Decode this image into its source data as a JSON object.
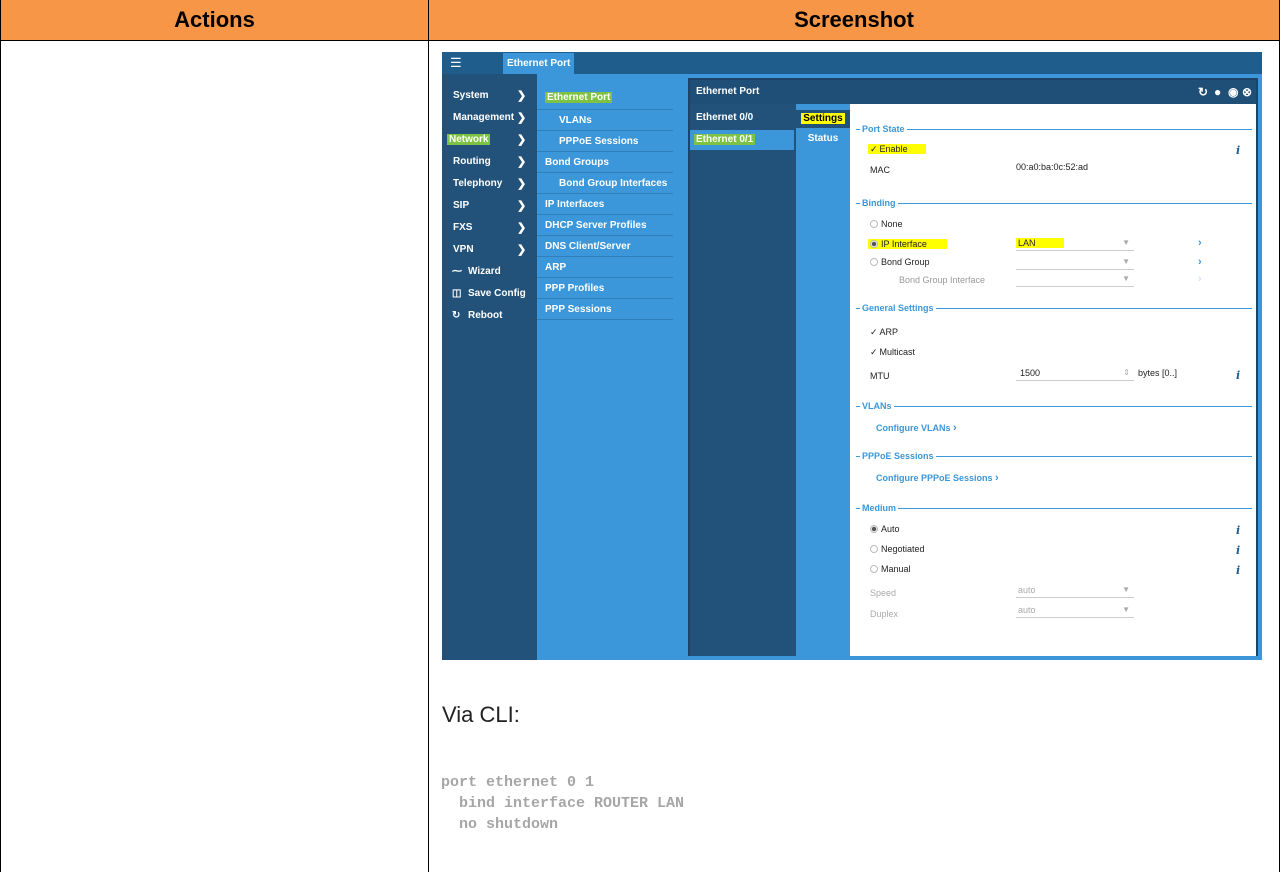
{
  "table": {
    "header_actions": "Actions",
    "header_screenshot": "Screenshot",
    "header_color": "#f79646"
  },
  "ui": {
    "topbar_tab": "Ethernet Port",
    "nav1": [
      "System",
      "Management",
      "Network",
      "Routing",
      "Telephony",
      "SIP",
      "FXS",
      "VPN"
    ],
    "nav1_actions": [
      {
        "label": "Wizard",
        "icon": "wand-icon"
      },
      {
        "label": "Save Config",
        "icon": "save-icon"
      },
      {
        "label": "Reboot",
        "icon": "reboot-icon"
      }
    ],
    "nav2": [
      {
        "label": "Ethernet Port",
        "indent": false
      },
      {
        "label": "VLANs",
        "indent": true
      },
      {
        "label": "PPPoE Sessions",
        "indent": true
      },
      {
        "label": "Bond Groups",
        "indent": false
      },
      {
        "label": "Bond Group Interfaces",
        "indent": true
      },
      {
        "label": "IP Interfaces",
        "indent": false
      },
      {
        "label": "DHCP Server Profiles",
        "indent": false
      },
      {
        "label": "DNS Client/Server",
        "indent": false
      },
      {
        "label": "ARP",
        "indent": false
      },
      {
        "label": "PPP Profiles",
        "indent": false
      },
      {
        "label": "PPP Sessions",
        "indent": false
      }
    ],
    "window_title": "Ethernet Port",
    "ports": [
      "Ethernet 0/0",
      "Ethernet 0/1"
    ],
    "tabs": [
      "Settings",
      "Status"
    ],
    "sections": {
      "port_state": "Port State",
      "binding": "Binding",
      "general": "General Settings",
      "vlans": "VLANs",
      "pppoe": "PPPoE Sessions",
      "medium": "Medium"
    },
    "enable_label": "Enable",
    "mac_label": "MAC",
    "mac_value": "00:a0:ba:0c:52:ad",
    "binding_none": "None",
    "binding_ip": "IP Interface",
    "binding_ip_value": "LAN",
    "binding_bond": "Bond Group",
    "binding_bond_iface": "Bond Group Interface",
    "arp_label": "ARP",
    "multicast_label": "Multicast",
    "mtu_label": "MTU",
    "mtu_value": "1500",
    "mtu_unit": "bytes [0..]",
    "configure_vlans": "Configure VLANs",
    "configure_pppoe": "Configure PPPoE Sessions",
    "medium_auto": "Auto",
    "medium_negotiated": "Negotiated",
    "medium_manual": "Manual",
    "speed_label": "Speed",
    "speed_value": "auto",
    "duplex_label": "Duplex",
    "duplex_value": "auto"
  },
  "cli": {
    "title": "Via CLI:",
    "code": "port ethernet 0 1\n  bind interface ROUTER LAN\n  no shutdown"
  }
}
